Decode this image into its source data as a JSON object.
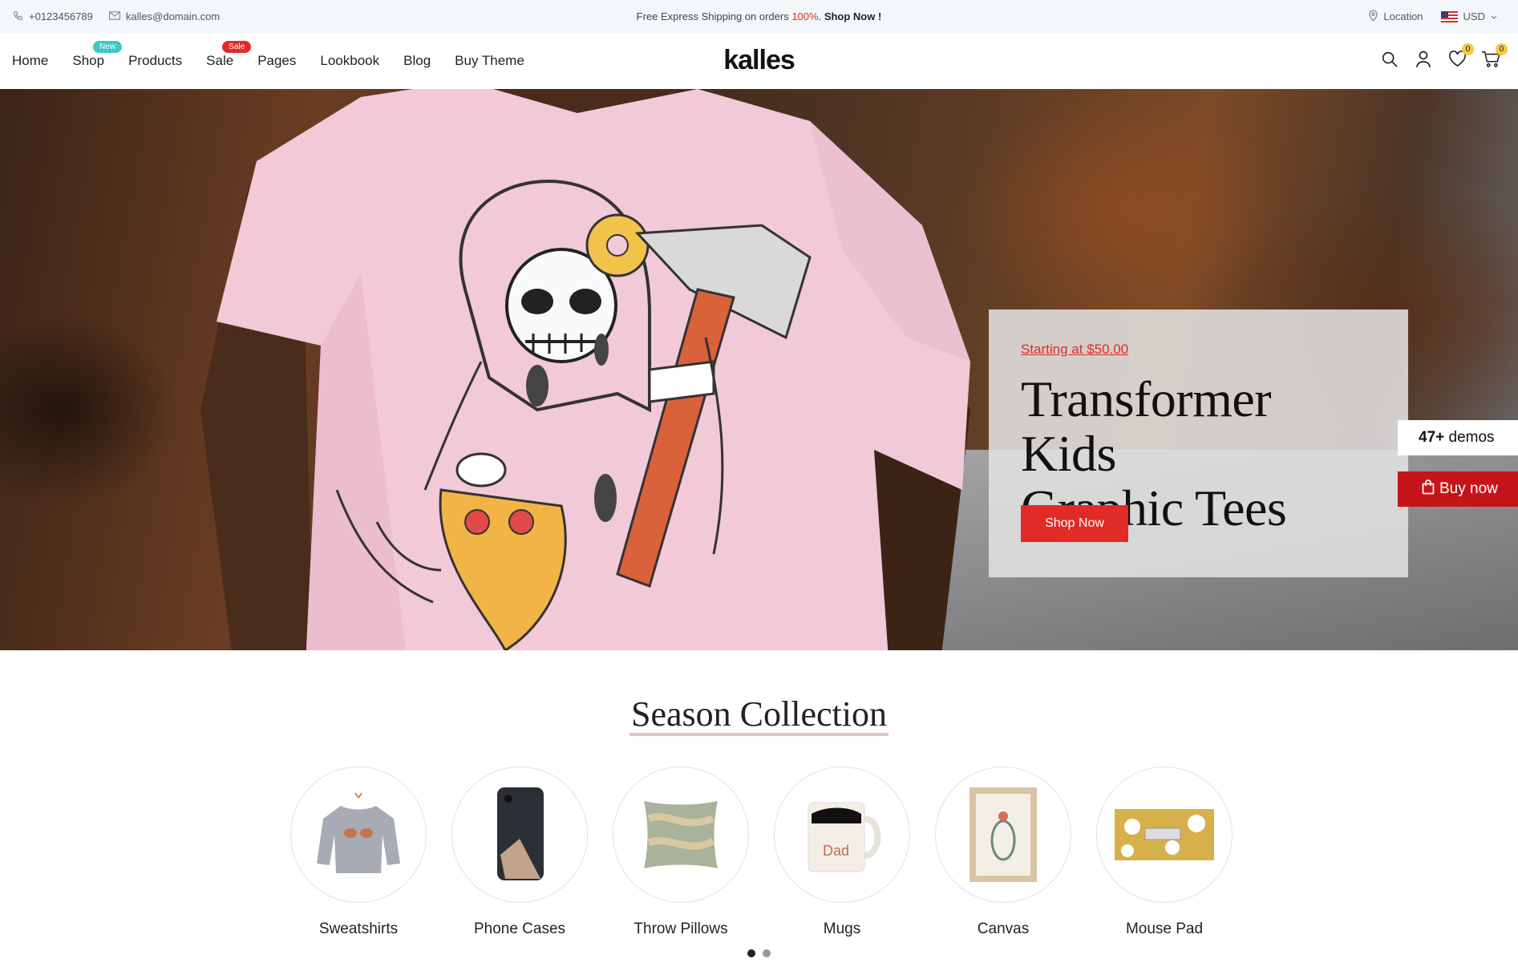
{
  "topbar": {
    "phone": "+0123456789",
    "email": "kalles@domain.com",
    "promo_text": "Free Express Shipping on orders ",
    "promo_percent": "100%",
    "promo_after": ". ",
    "promo_link": "Shop Now !",
    "location": "Location",
    "currency": "USD"
  },
  "nav": {
    "items": [
      {
        "label": "Home"
      },
      {
        "label": "Shop",
        "badge": "New"
      },
      {
        "label": "Products"
      },
      {
        "label": "Sale",
        "badge": "Sale"
      },
      {
        "label": "Pages"
      },
      {
        "label": "Lookbook"
      },
      {
        "label": "Blog"
      },
      {
        "label": "Buy Theme"
      }
    ]
  },
  "logo": "kalles",
  "header_icons": {
    "search": "search-icon",
    "account": "user-icon",
    "wishlist": "heart-icon",
    "wishlist_count": "0",
    "cart": "cart-icon",
    "cart_count": "0"
  },
  "hero": {
    "price_text": "Starting at $50.00",
    "title_line1": "Transformer Kids",
    "title_line2": "Graphic Tees",
    "button": "Shop Now"
  },
  "side": {
    "demos_count": "47+",
    "demos_label": " demos",
    "buy_label": "Buy now"
  },
  "collection": {
    "title": "Season Collection",
    "categories": [
      {
        "label": "Sweatshirts"
      },
      {
        "label": "Phone Cases"
      },
      {
        "label": "Throw Pillows"
      },
      {
        "label": "Mugs"
      },
      {
        "label": "Canvas"
      },
      {
        "label": "Mouse Pad"
      }
    ]
  },
  "colors": {
    "accent": "#e02b27",
    "badge_new": "#3ec7c5",
    "buy_now": "#c6151a",
    "topbar_bg": "#f3f7f9"
  }
}
